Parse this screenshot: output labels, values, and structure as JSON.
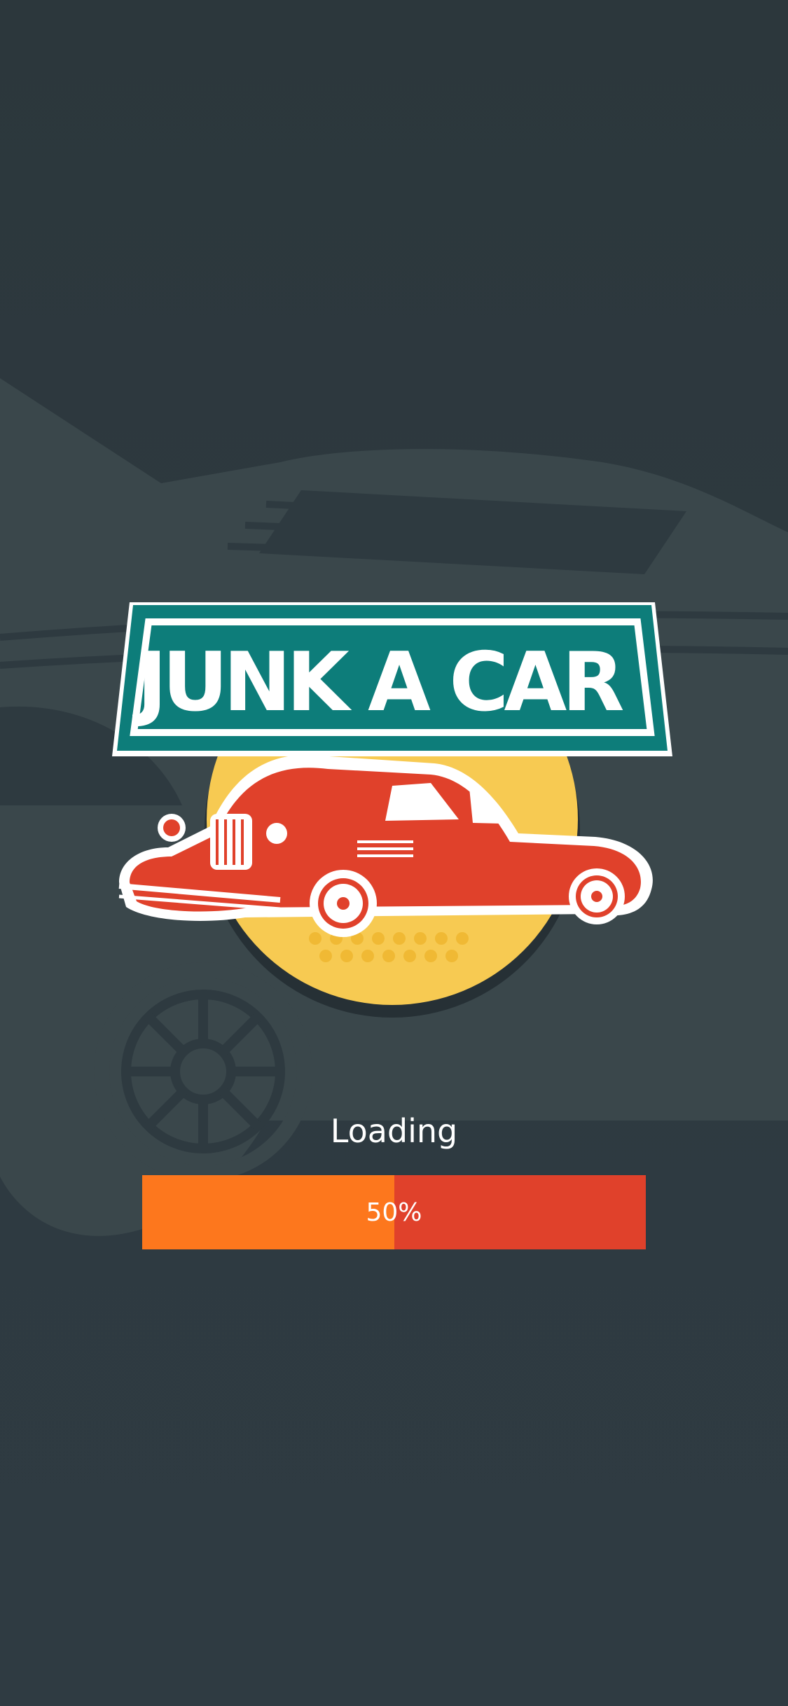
{
  "splash": {
    "logo_text": "JUNK A CAR",
    "loading_label": "Loading",
    "progress_text": "50%",
    "progress_value": 0.5
  },
  "icons": {
    "background": "background-car-illustration",
    "logo": "vintage-car-logo"
  },
  "colors": {
    "background": "#2c373c",
    "teal_banner": "#0d7d7a",
    "yellow_circle": "#f7ca52",
    "car_red": "#e0412b",
    "progress_fill": "#fd771d",
    "progress_track": "#e0412b"
  }
}
